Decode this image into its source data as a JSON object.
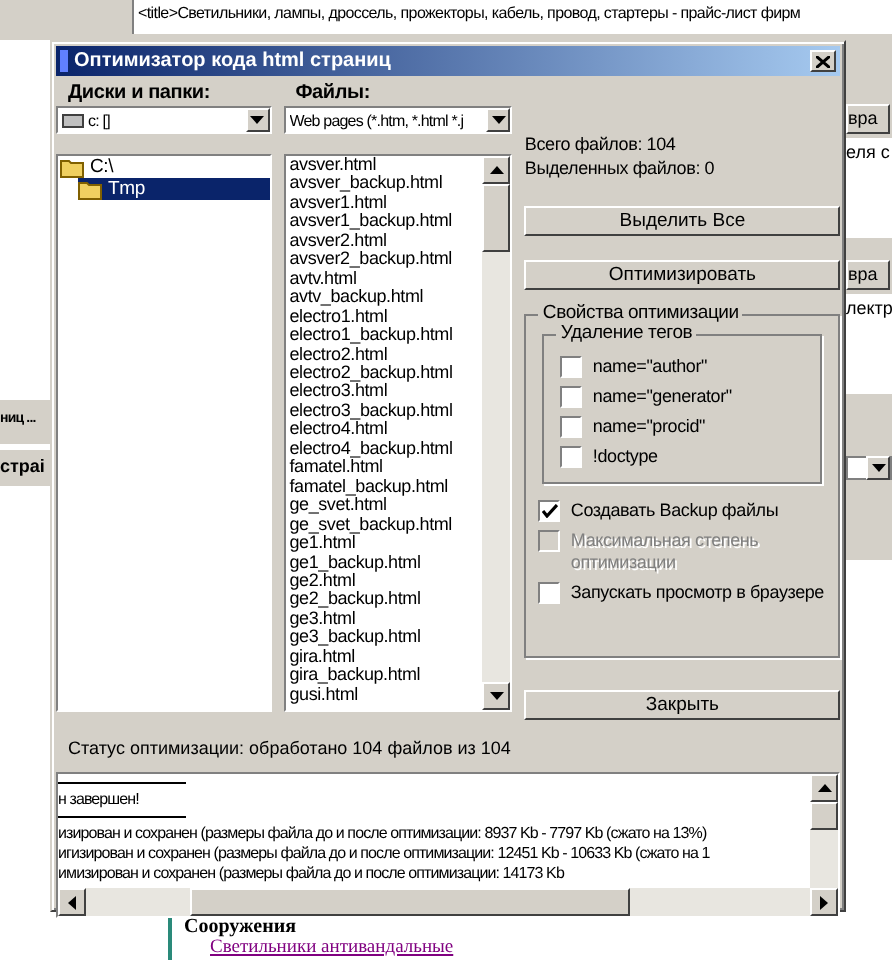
{
  "background": {
    "title_text": "<title>Светильники, лампы, дроссель, прожекторы, кабель, провод, стартеры - прайс-лист фирм",
    "right_buttons": [
      "вра",
      "вра"
    ],
    "right_texts": [
      "еля с",
      "лектр"
    ],
    "left_tabs": [
      "ниц ...",
      "страі"
    ],
    "bottom_heading": "Сооружения",
    "bottom_link": "Светильники антивандальные"
  },
  "window": {
    "title": "Оптимизатор кода html страниц"
  },
  "drives": {
    "label": "Диски и папки:",
    "value": "c: []"
  },
  "filter": {
    "label": "Файлы:",
    "value": "Web pages (*.htm, *.html *.j"
  },
  "folders": [
    {
      "name": "C:\\",
      "selected": false,
      "children": [
        {
          "name": "Tmp",
          "selected": true
        }
      ]
    }
  ],
  "files": [
    "avsver.html",
    "avsver_backup.html",
    "avsver1.html",
    "avsver1_backup.html",
    "avsver2.html",
    "avsver2_backup.html",
    "avtv.html",
    "avtv_backup.html",
    "electro1.html",
    "electro1_backup.html",
    "electro2.html",
    "electro2_backup.html",
    "electro3.html",
    "electro3_backup.html",
    "electro4.html",
    "electro4_backup.html",
    "famatel.html",
    "famatel_backup.html",
    "ge_svet.html",
    "ge_svet_backup.html",
    "ge1.html",
    "ge1_backup.html",
    "ge2.html",
    "ge2_backup.html",
    "ge3.html",
    "ge3_backup.html",
    "gira.html",
    "gira_backup.html",
    "gusi.html"
  ],
  "stats": [
    "Всего файлов: 104",
    "Выделенных файлов: 0"
  ],
  "buttons": [
    "Выделить Все",
    "Оптимизировать"
  ],
  "options_group": {
    "title": "Свойства оптимизации",
    "tags_group": {
      "title": "Удаление тегов",
      "items": [
        {
          "label": "name=\"author\"",
          "checked": false
        },
        {
          "label": "name=\"generator\"",
          "checked": false
        },
        {
          "label": "name=\"procid\"",
          "checked": false
        },
        {
          "label": "!doctype",
          "checked": false
        }
      ]
    },
    "items": [
      {
        "label": "Создавать Backup файлы",
        "checked": true,
        "disabled": false
      },
      {
        "label": "Максимальная степень оптимизации",
        "checked": false,
        "disabled": true
      },
      {
        "label": "Запускать просмотр в браузере",
        "checked": false,
        "disabled": false
      }
    ]
  },
  "close_button": "Закрыть",
  "status": "Статус оптимизации: обработано 104 файлов из 104",
  "log": [
    {
      "kind": "rule"
    },
    {
      "kind": "text",
      "text": "н завершен!"
    },
    {
      "kind": "rule"
    },
    {
      "kind": "text",
      "text": "изирован и сохранен (размеры файла до и после оптимизации: 8937 Kb - 7797 Kb (сжато на 13%)"
    },
    {
      "kind": "text",
      "text": "игизирован и сохранен (размеры файла до и после оптимизации: 12451 Kb - 10633 Kb (сжато на 1"
    },
    {
      "kind": "text",
      "text": "имизирован и сохранен (размеры файла до и после оптимизации: 14173 Kb"
    }
  ]
}
